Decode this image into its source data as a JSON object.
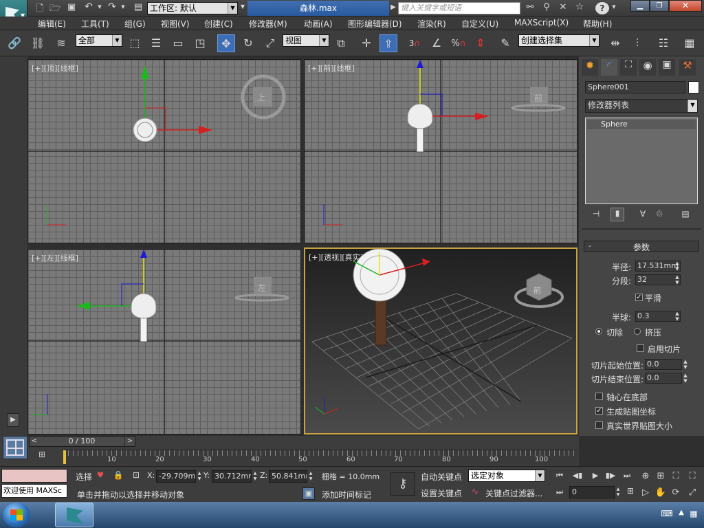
{
  "titlebar": {
    "workspace_label": "工作区: 默认",
    "file_name": "森林.max",
    "search_placeholder": "键入关键字或短语"
  },
  "menu": [
    "编辑(E)",
    "工具(T)",
    "组(G)",
    "视图(V)",
    "创建(C)",
    "修改器(M)",
    "动画(A)",
    "图形编辑器(D)",
    "渲染(R)",
    "自定义(U)",
    "MAXScript(X)",
    "帮助(H)"
  ],
  "toolbar": {
    "filter_value": "全部",
    "coord_value": "视图",
    "selection_set_placeholder": "创建选择集",
    "snap_3": "3",
    "snap_percent": "%"
  },
  "viewports": {
    "top": {
      "label": "[+][顶][线框]",
      "cube": "上"
    },
    "front": {
      "label": "[+][前][线框]",
      "cube": "前"
    },
    "left": {
      "label": "[+][左][线框]",
      "cube": "左"
    },
    "perspective": {
      "label": "[+][透视][真实]",
      "cube": "前"
    }
  },
  "panel": {
    "object_name": "Sphere001",
    "modifier_list": "修改器列表",
    "stack_item": "Sphere",
    "rollout_title": "参数",
    "radius_label": "半径:",
    "radius_value": "17.531mm",
    "segments_label": "分段:",
    "segments_value": "32",
    "smooth_label": "平滑",
    "hemisphere_label": "半球:",
    "hemisphere_value": "0.3",
    "chop_label": "切除",
    "squash_label": "挤压",
    "enable_slice_label": "启用切片",
    "slice_from_label": "切片起始位置:",
    "slice_from_value": "0.0",
    "slice_to_label": "切片结束位置:",
    "slice_to_value": "0.0",
    "base_to_pivot_label": "轴心在底部",
    "gen_mapping_label": "生成贴图坐标",
    "real_world_label": "真实世界贴图大小",
    "minus": "-"
  },
  "timeline": {
    "frame_counter": "0 / 100",
    "ticks": [
      "10",
      "20",
      "30",
      "40",
      "50",
      "60",
      "70",
      "80",
      "90",
      "100"
    ]
  },
  "status": {
    "welcome": "欢迎使用 MAXSc",
    "select_label": "选择",
    "prompt": "单击并拖动以选择并移动对象",
    "x_label": "X:",
    "x_value": "-29.709mm",
    "y_label": "Y:",
    "y_value": "30.712mm",
    "z_label": "Z:",
    "z_value": "50.841mm",
    "grid": "栅格 = 10.0mm",
    "add_time_tag": "添加时间标记",
    "auto_key": "自动关键点",
    "set_key": "设置关键点",
    "selected_obj": "选定对象",
    "key_filters": "关键点过滤器...",
    "frame_value": "0"
  }
}
